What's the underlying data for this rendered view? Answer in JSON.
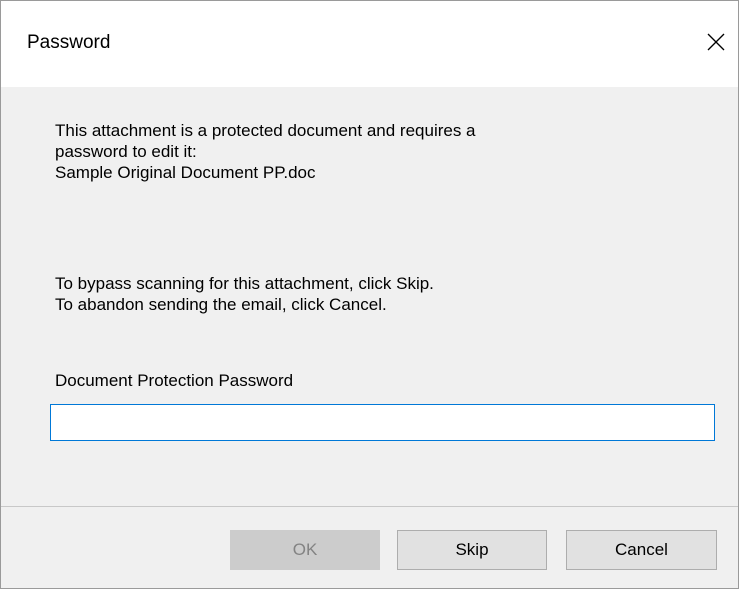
{
  "window": {
    "title": "Password"
  },
  "message": {
    "lines_1": [
      "This attachment is a protected document and requires a",
      "password to edit it:",
      "Sample Original Document PP.doc"
    ],
    "lines_2": [
      "To bypass scanning for this attachment, click Skip.",
      "To abandon sending the email, click Cancel."
    ]
  },
  "password_field": {
    "label": "Document Protection Password",
    "value": "",
    "placeholder": ""
  },
  "buttons": {
    "ok": "OK",
    "skip": "Skip",
    "cancel": "Cancel"
  },
  "icons": {
    "close": "close-icon"
  },
  "colors": {
    "focus_border": "#0078d7",
    "dialog_background": "#f0f0f0",
    "disabled_button": "#cccccc",
    "disabled_text": "#838383"
  }
}
